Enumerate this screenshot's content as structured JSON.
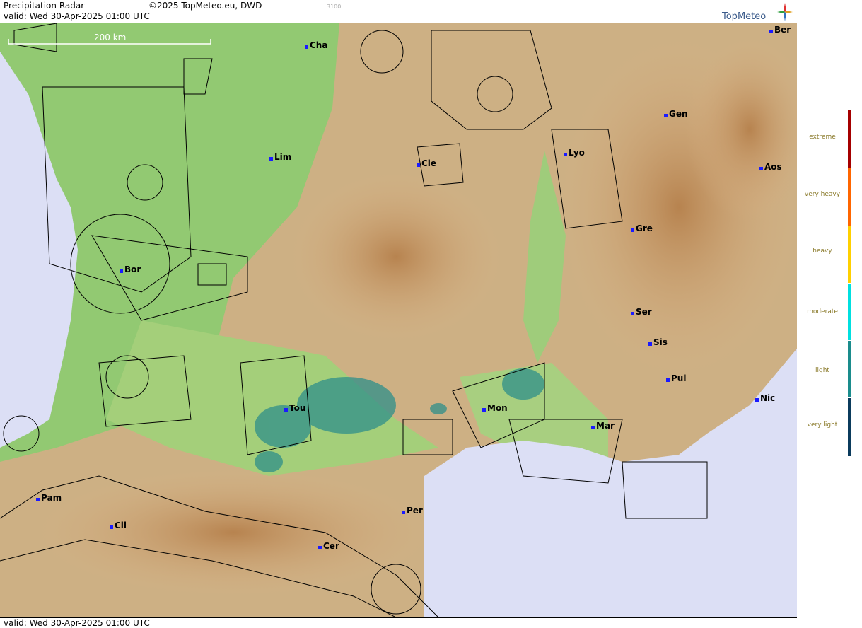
{
  "header": {
    "title": "Precipitation Radar",
    "valid": "valid:  Wed  30-Apr-2025 01:00 UTC",
    "copyright": "©2025 TopMeteo.eu, DWD",
    "code": "3100",
    "logo": "TopMeteo"
  },
  "scale_label": "200 km",
  "footer": {
    "valid": "valid:  Wed  30-Apr-2025 01:00 UTC"
  },
  "cities": [
    {
      "name": "Cha"
    },
    {
      "name": "Ber"
    },
    {
      "name": "Gen"
    },
    {
      "name": "Lim"
    },
    {
      "name": "Cle"
    },
    {
      "name": "Lyo"
    },
    {
      "name": "Aos"
    },
    {
      "name": "Gre"
    },
    {
      "name": "Bor"
    },
    {
      "name": "Ser"
    },
    {
      "name": "Sis"
    },
    {
      "name": "Pui"
    },
    {
      "name": "Tou"
    },
    {
      "name": "Mon"
    },
    {
      "name": "Mar"
    },
    {
      "name": "Nic"
    },
    {
      "name": "Pam"
    },
    {
      "name": "Cil"
    },
    {
      "name": "Per"
    },
    {
      "name": "Cer"
    }
  ],
  "legend": [
    {
      "label": "extreme",
      "color": "#a50000"
    },
    {
      "label": "very heavy",
      "color": "#ff6600"
    },
    {
      "label": "heavy",
      "color": "#ffd000"
    },
    {
      "label": "moderate",
      "color": "#00e0e0"
    },
    {
      "label": "light",
      "color": "#1a8c8c"
    },
    {
      "label": "very light",
      "color": "#0b3b5c"
    }
  ],
  "colors": {
    "sea": "#dcdff5",
    "lowland": "#8cc96a",
    "highland": "#c9935a",
    "precip": "#2f8f8a"
  }
}
